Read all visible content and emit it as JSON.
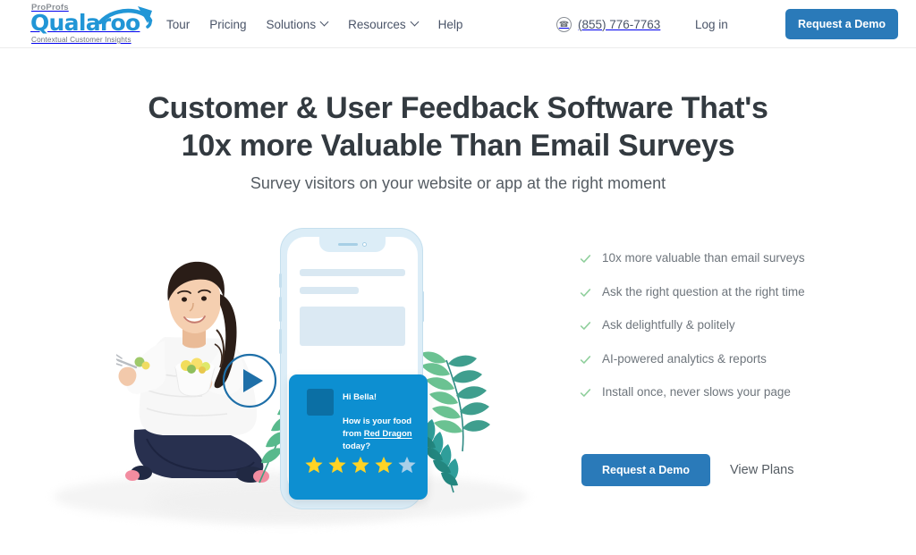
{
  "brand": {
    "parent_name": "ProProfs",
    "name": "Qualaroo",
    "tagline": "Contextual Customer Insights",
    "accent_color": "#2196d6",
    "button_color": "#2a7ab9",
    "logo_icon": "kangaroo-swoosh-icon"
  },
  "header": {
    "nav": [
      {
        "label": "Tour",
        "has_dropdown": false
      },
      {
        "label": "Pricing",
        "has_dropdown": false
      },
      {
        "label": "Solutions",
        "has_dropdown": true
      },
      {
        "label": "Resources",
        "has_dropdown": true
      },
      {
        "label": "Help",
        "has_dropdown": false
      }
    ],
    "phone_icon": "phone-icon",
    "phone_number": "(855) 776-7763",
    "login_label": "Log in",
    "demo_button_label": "Request a Demo"
  },
  "hero": {
    "title_line1": "Customer & User Feedback Software That's",
    "title_line2": "10x more Valuable Than Email Surveys",
    "subtitle": "Survey visitors on your website or app at the right moment"
  },
  "features": {
    "check_icon": "check-icon",
    "check_color": "#8fcf9c",
    "items": [
      "10x more valuable than email surveys",
      "Ask the right question at the right time",
      "Ask delightfully & politely",
      "AI-powered analytics & reports",
      "Install once, never slows your page"
    ]
  },
  "cta": {
    "primary_label": "Request a Demo",
    "secondary_label": "View Plans"
  },
  "illustration": {
    "play_button_icon": "play-icon",
    "woman_image": "woman-eating-salad-photo",
    "plant_left_icon": "fern-frond-icon",
    "plant_right_icon": "fern-frond-icon",
    "phone": {
      "device_icon": "smartphone-mockup-icon",
      "survey": {
        "avatar_icon": "avatar-placeholder-icon",
        "greeting": "Hi Bella!",
        "question_line1": "How is your food",
        "question_prefix2": "from ",
        "question_brand": "Red Dragon",
        "question_suffix2": " today?",
        "rating_value": 4,
        "rating_max": 5,
        "star_filled_color": "#ffd324",
        "star_empty_color": "#a9cfe8",
        "card_color": "#0d8fd1"
      }
    }
  }
}
